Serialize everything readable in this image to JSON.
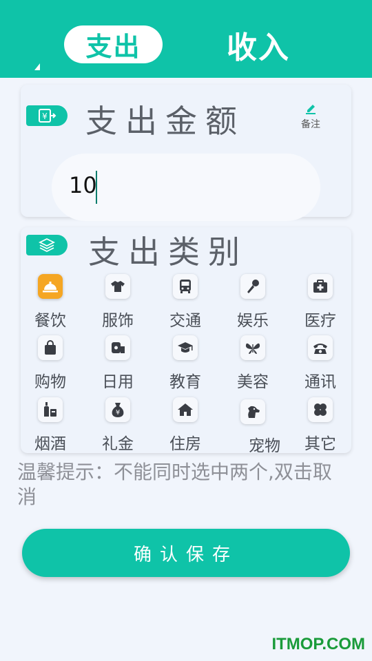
{
  "header": {
    "tab_expense": "支出",
    "tab_income": "收入",
    "accent_color": "#0fc3a8"
  },
  "amount_card": {
    "title": "支出金额",
    "note_label": "备注",
    "amount_value": "10",
    "badge_icon": "yuan-exchange-icon",
    "note_icon": "pencil-icon"
  },
  "category_card": {
    "title": "支出类别",
    "badge_icon": "layers-icon",
    "selected": "餐饮",
    "items": [
      {
        "label": "餐饮",
        "icon": "food-cloche-icon"
      },
      {
        "label": "服饰",
        "icon": "shirt-icon"
      },
      {
        "label": "交通",
        "icon": "bus-icon"
      },
      {
        "label": "娱乐",
        "icon": "microphone-icon"
      },
      {
        "label": "医疗",
        "icon": "medical-kit-icon"
      },
      {
        "label": "购物",
        "icon": "shopping-bag-icon"
      },
      {
        "label": "日用",
        "icon": "tissue-roll-icon"
      },
      {
        "label": "教育",
        "icon": "graduation-cap-icon"
      },
      {
        "label": "美容",
        "icon": "butterfly-icon"
      },
      {
        "label": "通讯",
        "icon": "telephone-icon"
      },
      {
        "label": "烟酒",
        "icon": "bottle-icon"
      },
      {
        "label": "礼金",
        "icon": "money-bag-icon"
      },
      {
        "label": "住房",
        "icon": "house-icon"
      },
      {
        "label": "宠物",
        "icon": "dog-icon"
      },
      {
        "label": "其它",
        "icon": "clover-icon"
      }
    ]
  },
  "tip_text": "温馨提示：不能同时选中两个,双击取消",
  "save_button_label": "确认保存",
  "watermark": "ITMOP.COM"
}
